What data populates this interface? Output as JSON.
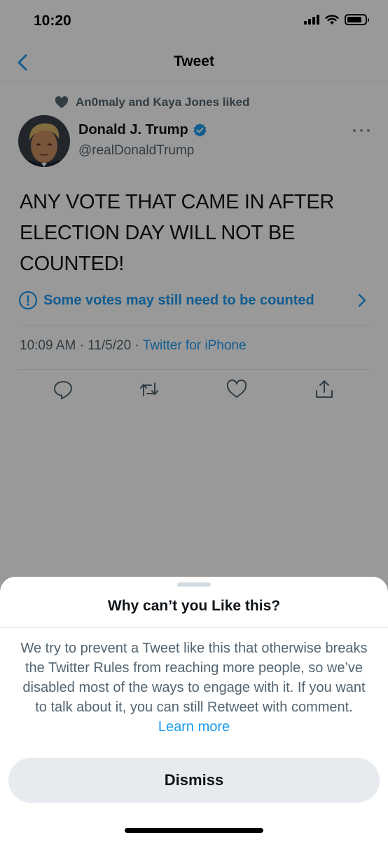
{
  "status_bar": {
    "time": "10:20"
  },
  "nav": {
    "title": "Tweet"
  },
  "tweet": {
    "social_context": "An0maly and Kaya Jones liked",
    "author_name": "Donald J. Trump",
    "author_handle": "@realDonaldTrump",
    "text": "ANY VOTE THAT CAME IN AFTER ELECTION DAY WILL NOT BE COUNTED!",
    "notice": "Some votes may still need to be counted",
    "time": "10:09 AM",
    "date": "11/5/20",
    "source": "Twitter for iPhone",
    "separator": "·"
  },
  "sheet": {
    "title": "Why can’t you Like this?",
    "body": "We try to prevent a Tweet like this that otherwise breaks the Twitter Rules from reaching more people, so we’ve disabled most of the ways to engage with it. If you want to talk about it, you can still Retweet with comment.",
    "learn_more": "Learn more",
    "dismiss_label": "Dismiss"
  },
  "colors": {
    "accent": "#1d9bf0",
    "verified": "#1d9bf0",
    "secondary_text": "#536471",
    "overlay": "rgba(0,0,0,0.40)"
  },
  "icons": {
    "back": "chevron-left-icon",
    "liked_by": "heart-icon",
    "verified": "verified-badge-icon",
    "more": "more-horizontal-icon",
    "notice": "exclamation-circle-icon",
    "notice_arrow": "chevron-right-icon",
    "reply": "reply-icon",
    "retweet": "retweet-icon",
    "like": "like-icon",
    "share": "share-icon"
  }
}
